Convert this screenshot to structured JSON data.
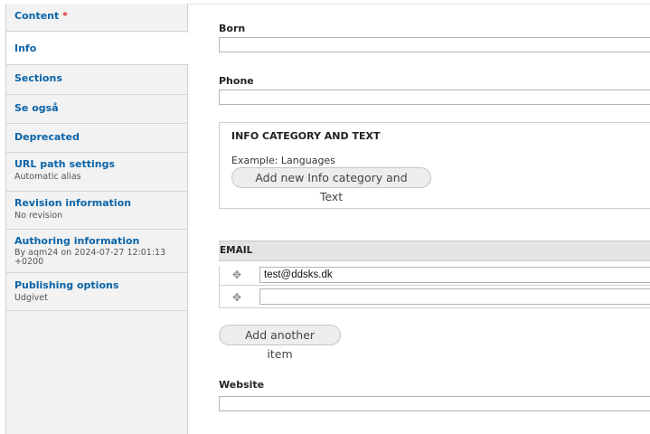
{
  "sidebar": {
    "items": [
      {
        "label": "Content",
        "required_mark": "*",
        "summary": ""
      },
      {
        "label": "Info",
        "summary": ""
      },
      {
        "label": "Sections",
        "summary": ""
      },
      {
        "label": "Se også",
        "summary": ""
      },
      {
        "label": "Deprecated",
        "summary": ""
      },
      {
        "label": "URL path settings",
        "summary": "Automatic alias"
      },
      {
        "label": "Revision information",
        "summary": "No revision"
      },
      {
        "label": "Authoring information",
        "summary": "By aqm24 on 2024-07-27 12:01:13 +0200"
      },
      {
        "label": "Publishing options",
        "summary": "Udgivet"
      }
    ]
  },
  "form": {
    "born": {
      "label": "Born",
      "value": ""
    },
    "phone": {
      "label": "Phone",
      "value": ""
    },
    "info_category": {
      "legend": "INFO CATEGORY AND TEXT",
      "description": "Example: Languages",
      "add_button": "Add new Info category and Text"
    },
    "email": {
      "header": "EMAIL",
      "rows": [
        {
          "value": "test@ddsks.dk"
        },
        {
          "value": ""
        }
      ],
      "add_button": "Add another item"
    },
    "website": {
      "label": "Website",
      "value": ""
    }
  },
  "icons": {
    "drag_handle": "drag-handle-icon"
  },
  "colors": {
    "link": "#0a64a8",
    "required": "#e0312e",
    "sidebar_bg": "#f2f2f2"
  }
}
